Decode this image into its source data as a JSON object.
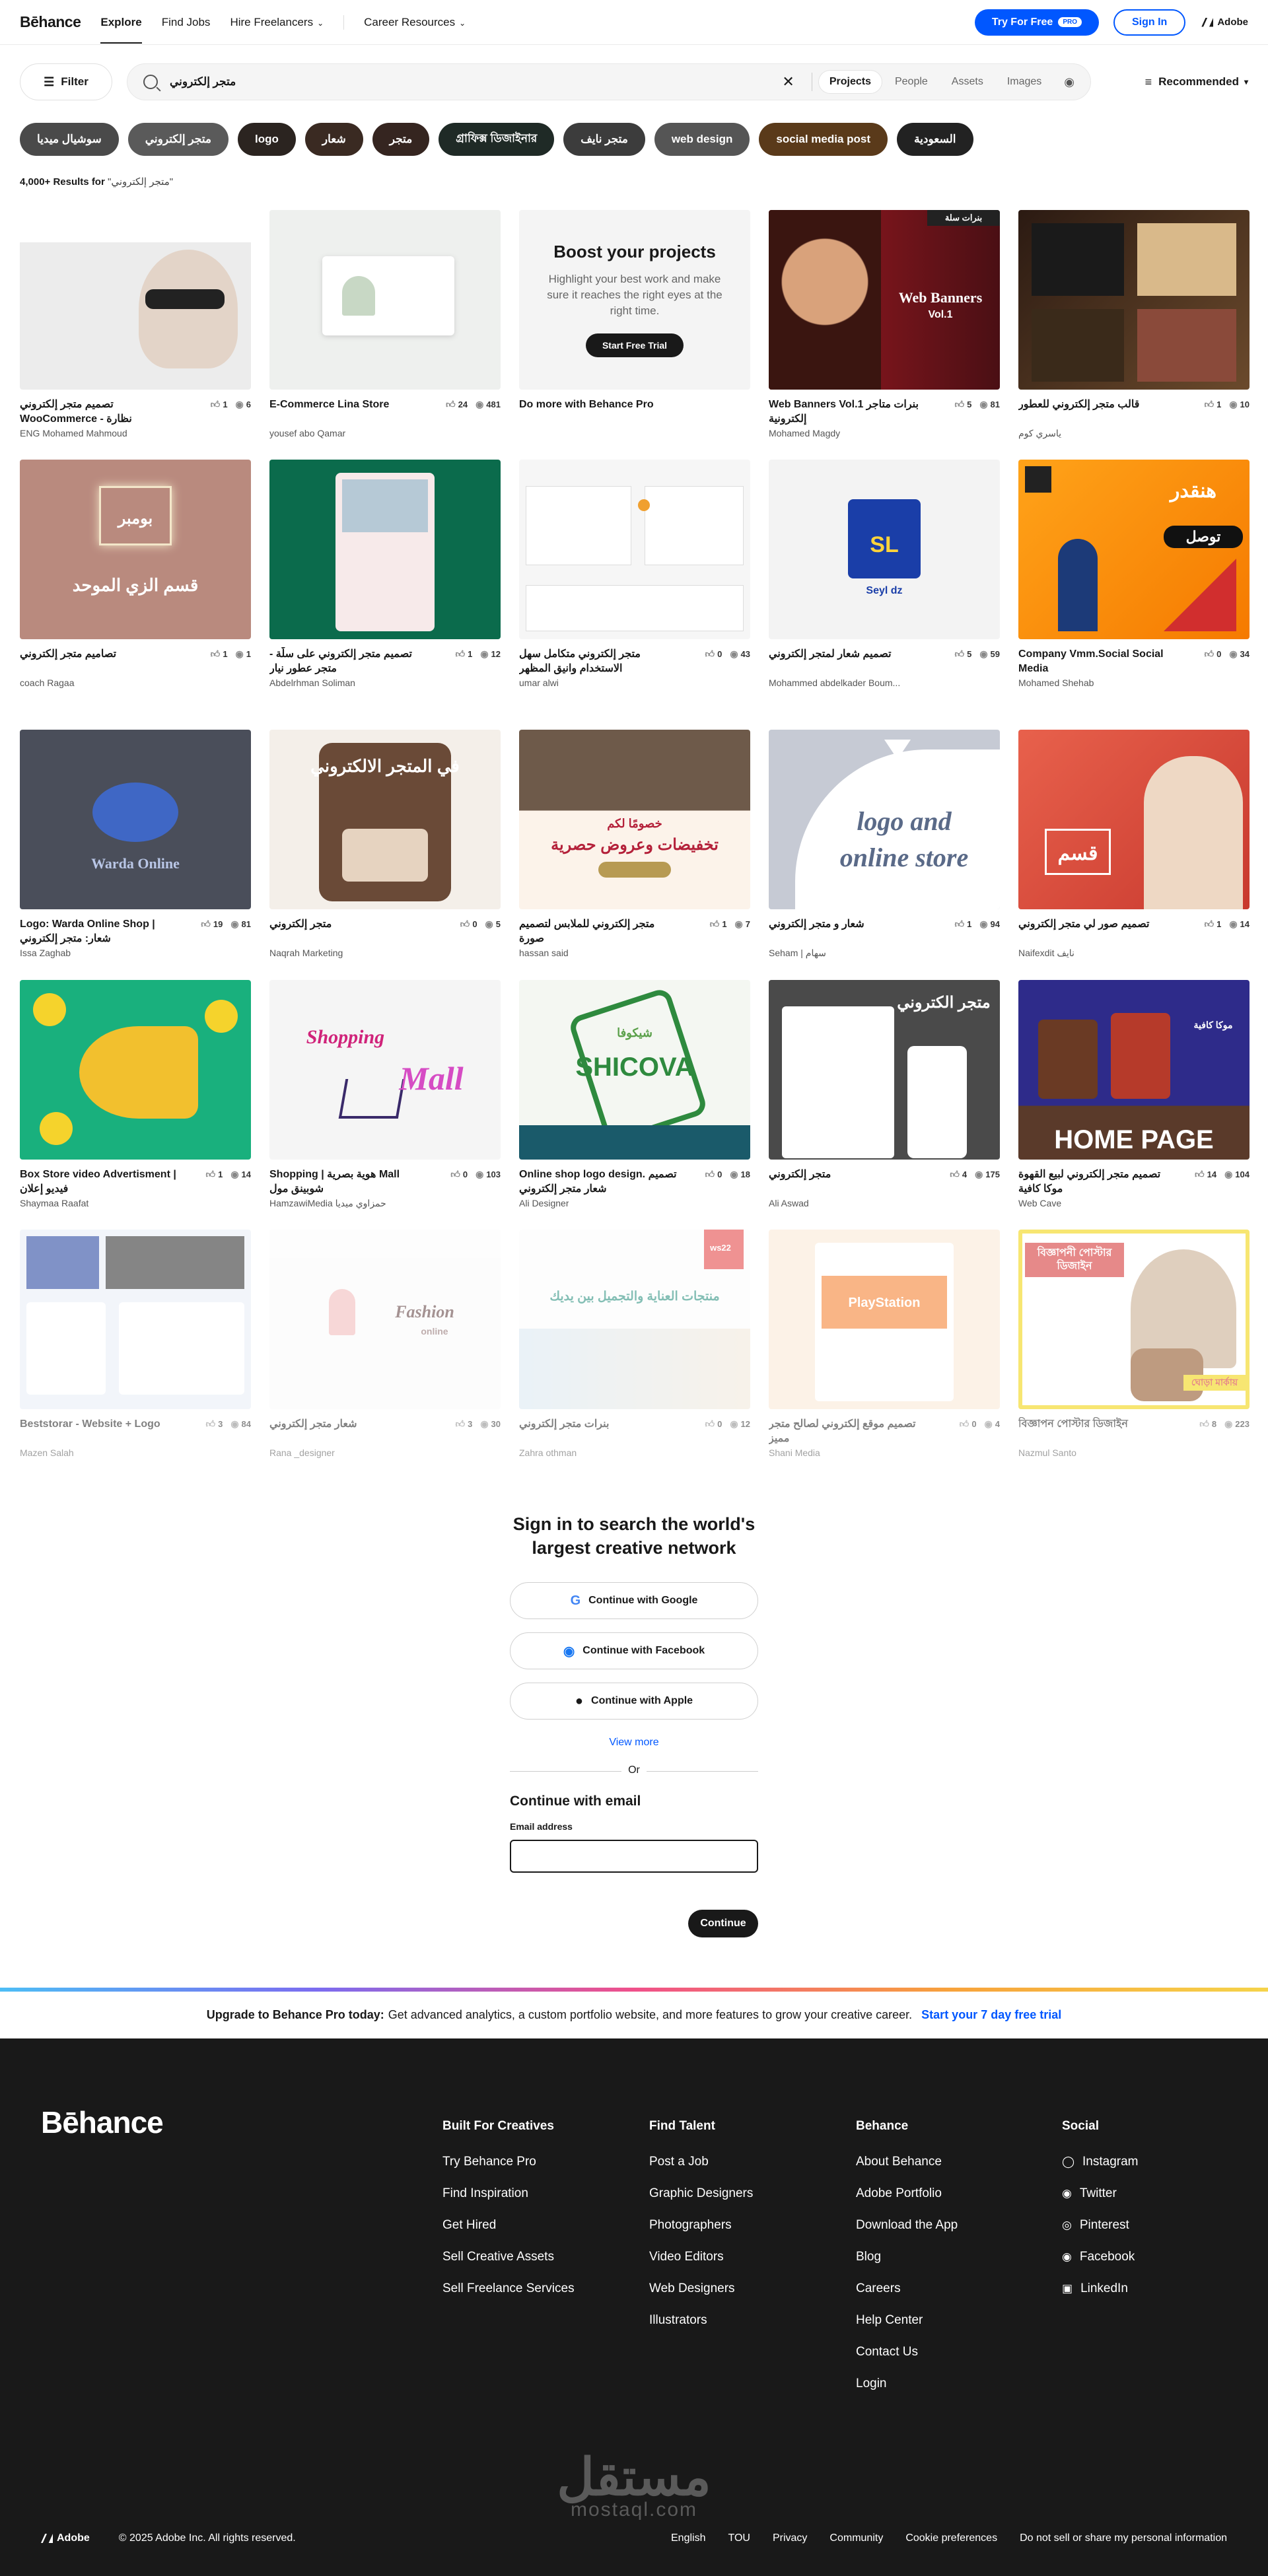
{
  "nav": {
    "logo": "Bēhance",
    "explore": "Explore",
    "find_jobs": "Find Jobs",
    "hire": "Hire Freelancers",
    "career": "Career Resources",
    "try_free": "Try For Free",
    "pro_badge": "PRO",
    "sign_in": "Sign In",
    "adobe": "Adobe"
  },
  "search": {
    "filter": "Filter",
    "query": "متجر إلكتروني",
    "tabs": [
      "Projects",
      "People",
      "Assets",
      "Images"
    ],
    "active_tab": "Projects",
    "sort": "Recommended"
  },
  "chips": [
    {
      "label": "سوشيال ميديا",
      "color": "#4a4a4a"
    },
    {
      "label": "متجر إلكتروني",
      "color": "#5a5a5a"
    },
    {
      "label": "logo",
      "color": "#2b2420"
    },
    {
      "label": "شعار",
      "color": "#3a2a22"
    },
    {
      "label": "متجر",
      "color": "#352520"
    },
    {
      "label": "গ্রাফিক্স ডিজাইনার",
      "color": "#1f2a26"
    },
    {
      "label": "متجر نايف",
      "color": "#3c3c3c"
    },
    {
      "label": "web design",
      "color": "#555555"
    },
    {
      "label": "social media post",
      "color": "#5a3a1a"
    },
    {
      "label": "السعودية",
      "color": "#222222"
    }
  ],
  "results": {
    "count": "4,000+ Results for",
    "query": "\"متجر إلكتروني\""
  },
  "cards": [
    {
      "title": "تصميم متجر إلكتروني WooCommerce - نظارة",
      "owner": "ENG Mohamed Mahmoud",
      "likes": "1",
      "views": "6"
    },
    {
      "title": "E-Commerce Lina Store",
      "owner": "yousef abo Qamar",
      "likes": "24",
      "views": "481"
    },
    {
      "title": "Do more with Behance Pro",
      "owner": "",
      "likes": "",
      "views": "",
      "promo": {
        "heading": "Boost your projects",
        "text": "Highlight your best work and make sure it reaches the right eyes at the right time.",
        "button": "Start Free Trial"
      }
    },
    {
      "title": "Web Banners Vol.1 بنرات متاجر إلكترونية",
      "owner": "Mohamed Magdy",
      "likes": "5",
      "views": "81",
      "art": "Web Banners",
      "art2": "Vol.1",
      "tag": "بنرات سلة"
    },
    {
      "title": "قالب متجر إلكتروني للعطور",
      "owner": "ياسري كوم",
      "likes": "1",
      "views": "10"
    },
    {
      "title": "تصاميم متجر إلكتروني",
      "owner": "coach Ragaa",
      "likes": "1",
      "views": "1",
      "art": "قسم الزي الموحد",
      "art2": "بومبر"
    },
    {
      "title": "تصميم متجر إلكتروني على سلّة - متجر عطور نيار",
      "owner": "Abdelrhman Soliman",
      "likes": "1",
      "views": "12"
    },
    {
      "title": "متجر إلكتروني متكامل سهل الاستخدام وانيق المظهر",
      "owner": "umar alwi",
      "likes": "0",
      "views": "43"
    },
    {
      "title": "تصميم شعار لمتجر إلكتروني",
      "owner": "Mohammed abdelkader Boum...",
      "likes": "5",
      "views": "59",
      "art": "SL",
      "art2": "Seyl dz"
    },
    {
      "title": "Company Vmm.Social Social Media",
      "owner": "Mohamed Shehab",
      "likes": "0",
      "views": "34",
      "art": "هنقدر",
      "art2": "توصل"
    },
    {
      "title": "Logo: Warda Online Shop | شعار: متجر إلكتروني",
      "owner": "Issa Zaghab",
      "likes": "19",
      "views": "81",
      "art": "Warda Online"
    },
    {
      "title": "متجر إلكتروني",
      "owner": "Naqrah Marketing",
      "likes": "0",
      "views": "5",
      "art": "في المتجر الالكتروني"
    },
    {
      "title": "متجر إلكتروني للملابس لتصميم صورة",
      "owner": "hassan said",
      "likes": "1",
      "views": "7",
      "art": "تخفيضات وعروض حصرية",
      "art2": "خصومًا لكم"
    },
    {
      "title": "شعار و متجر إلكتروني",
      "owner": "Seham | سهام",
      "likes": "1",
      "views": "94",
      "art": "logo and",
      "art2": "online store"
    },
    {
      "title": "تصميم صور لي متجر إلكتروني",
      "owner": "Naifexdit نايف",
      "likes": "1",
      "views": "14",
      "art": "قسم"
    },
    {
      "title": "Box Store video Advertisment | فيديو إعلان",
      "owner": "Shaymaa Raafat",
      "likes": "1",
      "views": "14"
    },
    {
      "title": "Shopping | هوية بصرية Mall شوبينق مول",
      "owner": "HamzawiMedia حمزاوي ميديا",
      "likes": "0",
      "views": "103",
      "art": "Shopping",
      "art2": "Mall"
    },
    {
      "title": "Online shop logo design. تصميم شعار متجر إلكتروني",
      "owner": "Ali Designer",
      "likes": "0",
      "views": "18",
      "art": "SHICOVA",
      "art2": "شيكوفا"
    },
    {
      "title": "متجر إلكتروني",
      "owner": "Ali Aswad",
      "likes": "4",
      "views": "175",
      "art": "متجر الكتروني"
    },
    {
      "title": "تصميم متجر إلكتروني لبيع القهوة موكا كافية",
      "owner": "Web Cave",
      "likes": "14",
      "views": "104",
      "art": "HOME PAGE",
      "art2": "موكا كافية"
    },
    {
      "title": "Beststorar - Website + Logo",
      "owner": "Mazen Salah",
      "likes": "3",
      "views": "84"
    },
    {
      "title": "شعار متجر إلكتروني",
      "owner": "Rana _designer",
      "likes": "3",
      "views": "30",
      "art": "Fashion",
      "art2": "online"
    },
    {
      "title": "بنرات متجر إلكتروني",
      "owner": "Zahra othman",
      "likes": "0",
      "views": "12",
      "art": "منتجات العناية والتجميل بين يديك",
      "art2": "ws22"
    },
    {
      "title": "تصميم موقع إلكتروني لصالح متجر مميز",
      "owner": "Shani Media",
      "likes": "0",
      "views": "4",
      "art": "PlayStation"
    },
    {
      "title": "বিজ্ঞাপন পোস্টার ডিজাইন",
      "owner": "Nazmul Santo",
      "likes": "8",
      "views": "223",
      "art": "বিজ্ঞাপনী পোস্টার ডিজাইন",
      "art2": "ঘোড়া মার্কায়"
    }
  ],
  "signin": {
    "heading": "Sign in to search the world's largest creative network",
    "google": "Continue with Google",
    "facebook": "Continue with Facebook",
    "apple": "Continue with Apple",
    "view_more": "View more",
    "or": "Or",
    "email_heading": "Continue with email",
    "email_label": "Email address",
    "continue": "Continue"
  },
  "upgrade": {
    "bold": "Upgrade to Behance Pro today:",
    "text": "Get advanced analytics, a custom portfolio website, and more features to grow your creative career.",
    "link": "Start your 7 day free trial"
  },
  "footer": {
    "logo": "Bēhance",
    "columns": [
      {
        "heading": "Built For Creatives",
        "items": [
          "Try Behance Pro",
          "Find Inspiration",
          "Get Hired",
          "Sell Creative Assets",
          "Sell Freelance Services"
        ]
      },
      {
        "heading": "Find Talent",
        "items": [
          "Post a Job",
          "Graphic Designers",
          "Photographers",
          "Video Editors",
          "Web Designers",
          "Illustrators"
        ]
      },
      {
        "heading": "Behance",
        "items": [
          "About Behance",
          "Adobe Portfolio",
          "Download the App",
          "Blog",
          "Careers",
          "Help Center",
          "Contact Us",
          "Login"
        ]
      },
      {
        "heading": "Social",
        "items": [
          "Instagram",
          "Twitter",
          "Pinterest",
          "Facebook",
          "LinkedIn"
        ]
      }
    ],
    "watermark": "مستقل",
    "watermark2": "mostaql.com",
    "adobe": "Adobe",
    "copyright": "© 2025 Adobe Inc. All rights reserved.",
    "links": [
      "English",
      "TOU",
      "Privacy",
      "Community",
      "Cookie preferences",
      "Do not sell or share my personal information"
    ]
  }
}
